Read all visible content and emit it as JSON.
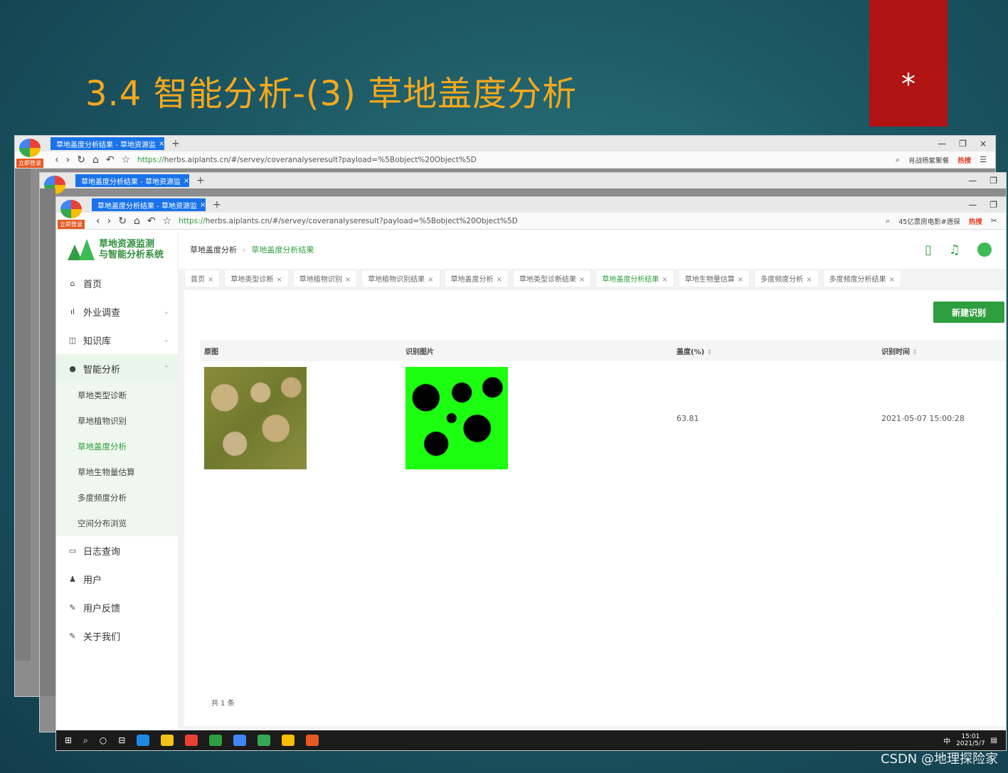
{
  "slide": {
    "title": "3.4  智能分析-(3) 草地盖度分析",
    "marker": "*",
    "watermark": "CSDN @地理探险家"
  },
  "browser": {
    "tab_title": "草地盖度分析结果 - 草地资源监",
    "login_badge": "立即登录",
    "url_scheme": "https://",
    "url_rest": "herbs.aiplants.cn/#/servey/coveranalyseresult?payload=%5Bobject%20Object%5D",
    "search_hint_back": "肖战杨紫聚餐",
    "search_hint_front": "45亿票房电影#唐探",
    "hot_label": "热搜"
  },
  "app": {
    "brand_line1": "草地资源监测",
    "brand_line2": "与智能分析系统",
    "breadcrumb": [
      "草地盖度分析",
      "草地盖度分析结果"
    ],
    "menu": [
      {
        "label": "首页",
        "icon": "home-icon",
        "glyph": "⌂"
      },
      {
        "label": "外业调查",
        "icon": "chart-bar-icon",
        "glyph": "ıl"
      },
      {
        "label": "知识库",
        "icon": "book-icon",
        "glyph": "◫"
      },
      {
        "label": "智能分析",
        "icon": "location-icon",
        "glyph": "●"
      }
    ],
    "submenu": [
      "草地类型诊断",
      "草地植物识别",
      "草地盖度分析",
      "草地生物量估算",
      "多度频度分析",
      "空间分布浏览"
    ],
    "menu_bottom": [
      {
        "label": "日志查询",
        "icon": "log-icon",
        "glyph": "▭"
      },
      {
        "label": "用户",
        "icon": "user-icon",
        "glyph": "♟"
      },
      {
        "label": "用户反馈",
        "icon": "feedback-icon",
        "glyph": "✎"
      },
      {
        "label": "关于我们",
        "icon": "about-icon",
        "glyph": "✎"
      }
    ],
    "tags": [
      "首页",
      "草地类型诊断",
      "草地植物识别",
      "草地植物识别结果",
      "草地盖度分析",
      "草地类型诊断结果",
      "草地盖度分析结果",
      "草地生物量估算",
      "多度频度分析",
      "多度频度分析结果"
    ],
    "active_tag_index": 6,
    "new_button": "新建识别",
    "table": {
      "headers": [
        "原图",
        "识别图片",
        "盖度(%)",
        "识别时间"
      ],
      "rows": [
        {
          "coverage": "63.81",
          "time": "2021-05-07 15:00:28"
        }
      ]
    },
    "total": "共 1 条"
  },
  "taskbar": {
    "clock_time": "15:01",
    "clock_date": "2021/5/7",
    "ime": "中"
  },
  "colors": {
    "accent_green": "#2e9e3e",
    "title_orange": "#f4a81d",
    "marker_red": "#b01313",
    "tab_blue": "#1a73e8"
  }
}
